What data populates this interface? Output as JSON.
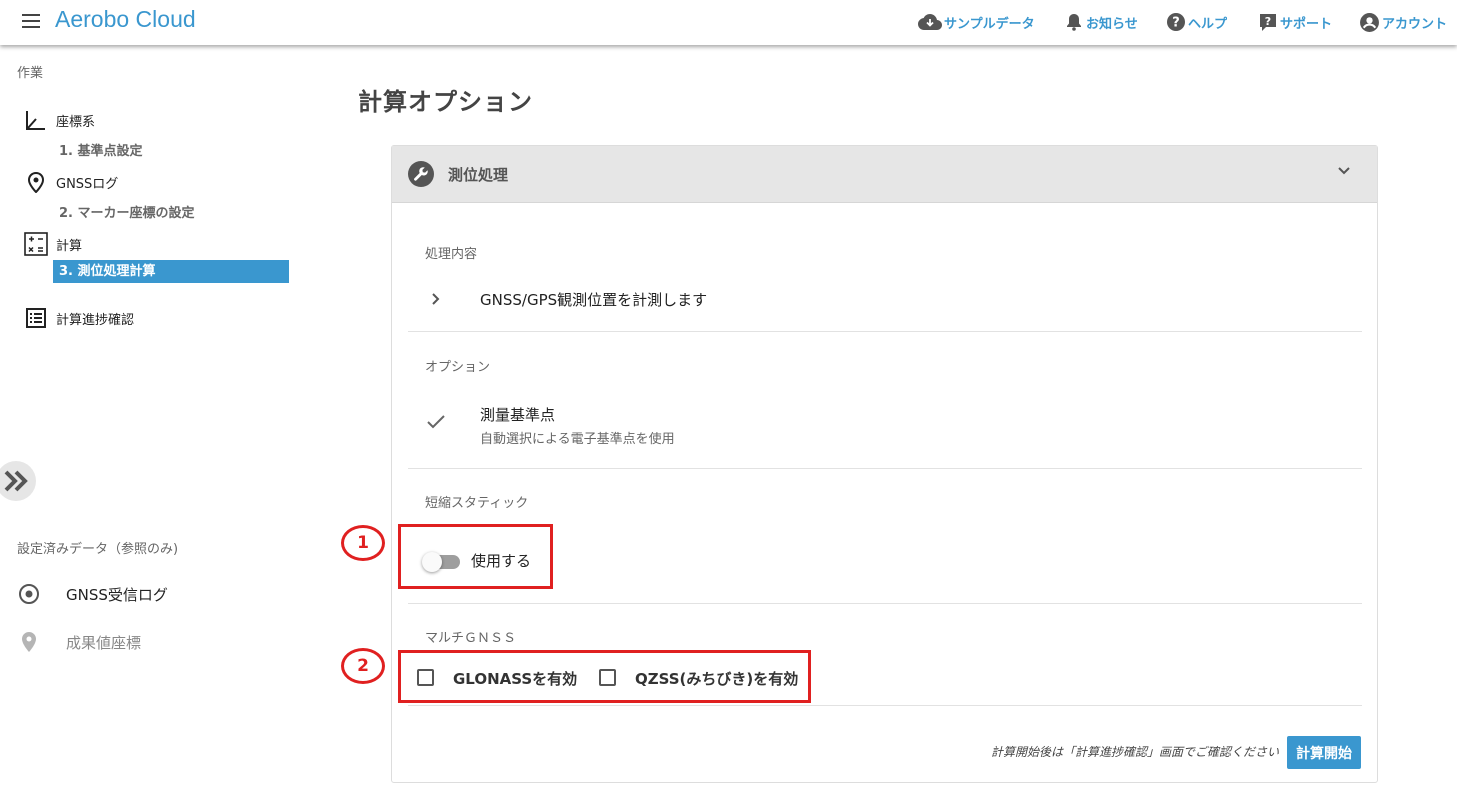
{
  "header": {
    "brand": "Aerobo Cloud",
    "links": {
      "sample_data": "サンプルデータ",
      "notifications": "お知らせ",
      "help": "ヘルプ",
      "support": "サポート",
      "account": "アカウント"
    },
    "accent_color": "#3a97cf"
  },
  "sidebar": {
    "heading": "作業",
    "items": {
      "coord": "座標系",
      "coord_sub": "1. 基準点設定",
      "gnss": "GNSSログ",
      "gnss_sub": "2. マーカー座標の設定",
      "calc": "計算",
      "calc_sub": "3. 測位処理計算",
      "progress": "計算進捗確認"
    },
    "ref_heading": "設定済みデータ（参照のみ)",
    "ref_items": {
      "gnss_log": "GNSS受信ログ",
      "result_coords": "成果値座標"
    }
  },
  "main": {
    "title": "計算オプション",
    "panel": {
      "title": "測位処理",
      "processing_label": "処理内容",
      "processing_text": "GNSS/GPS観測位置を計測します",
      "option_label": "オプション",
      "option_title": "測量基準点",
      "option_sub": "自動選択による電子基準点を使用",
      "static_label": "短縮スタティック",
      "static_toggle_label": "使用する",
      "static_toggle_on": false,
      "multi_label": "マルチＧＮＳＳ",
      "glonass_label": "GLONASSを有効",
      "glonass_checked": false,
      "qzss_label": "QZSS(みちびき)を有効",
      "qzss_checked": false,
      "footer_note": "計算開始後は「計算進捗確認」画面でご確認ください",
      "start_button": "計算開始"
    },
    "annotations": [
      "1",
      "2"
    ]
  }
}
